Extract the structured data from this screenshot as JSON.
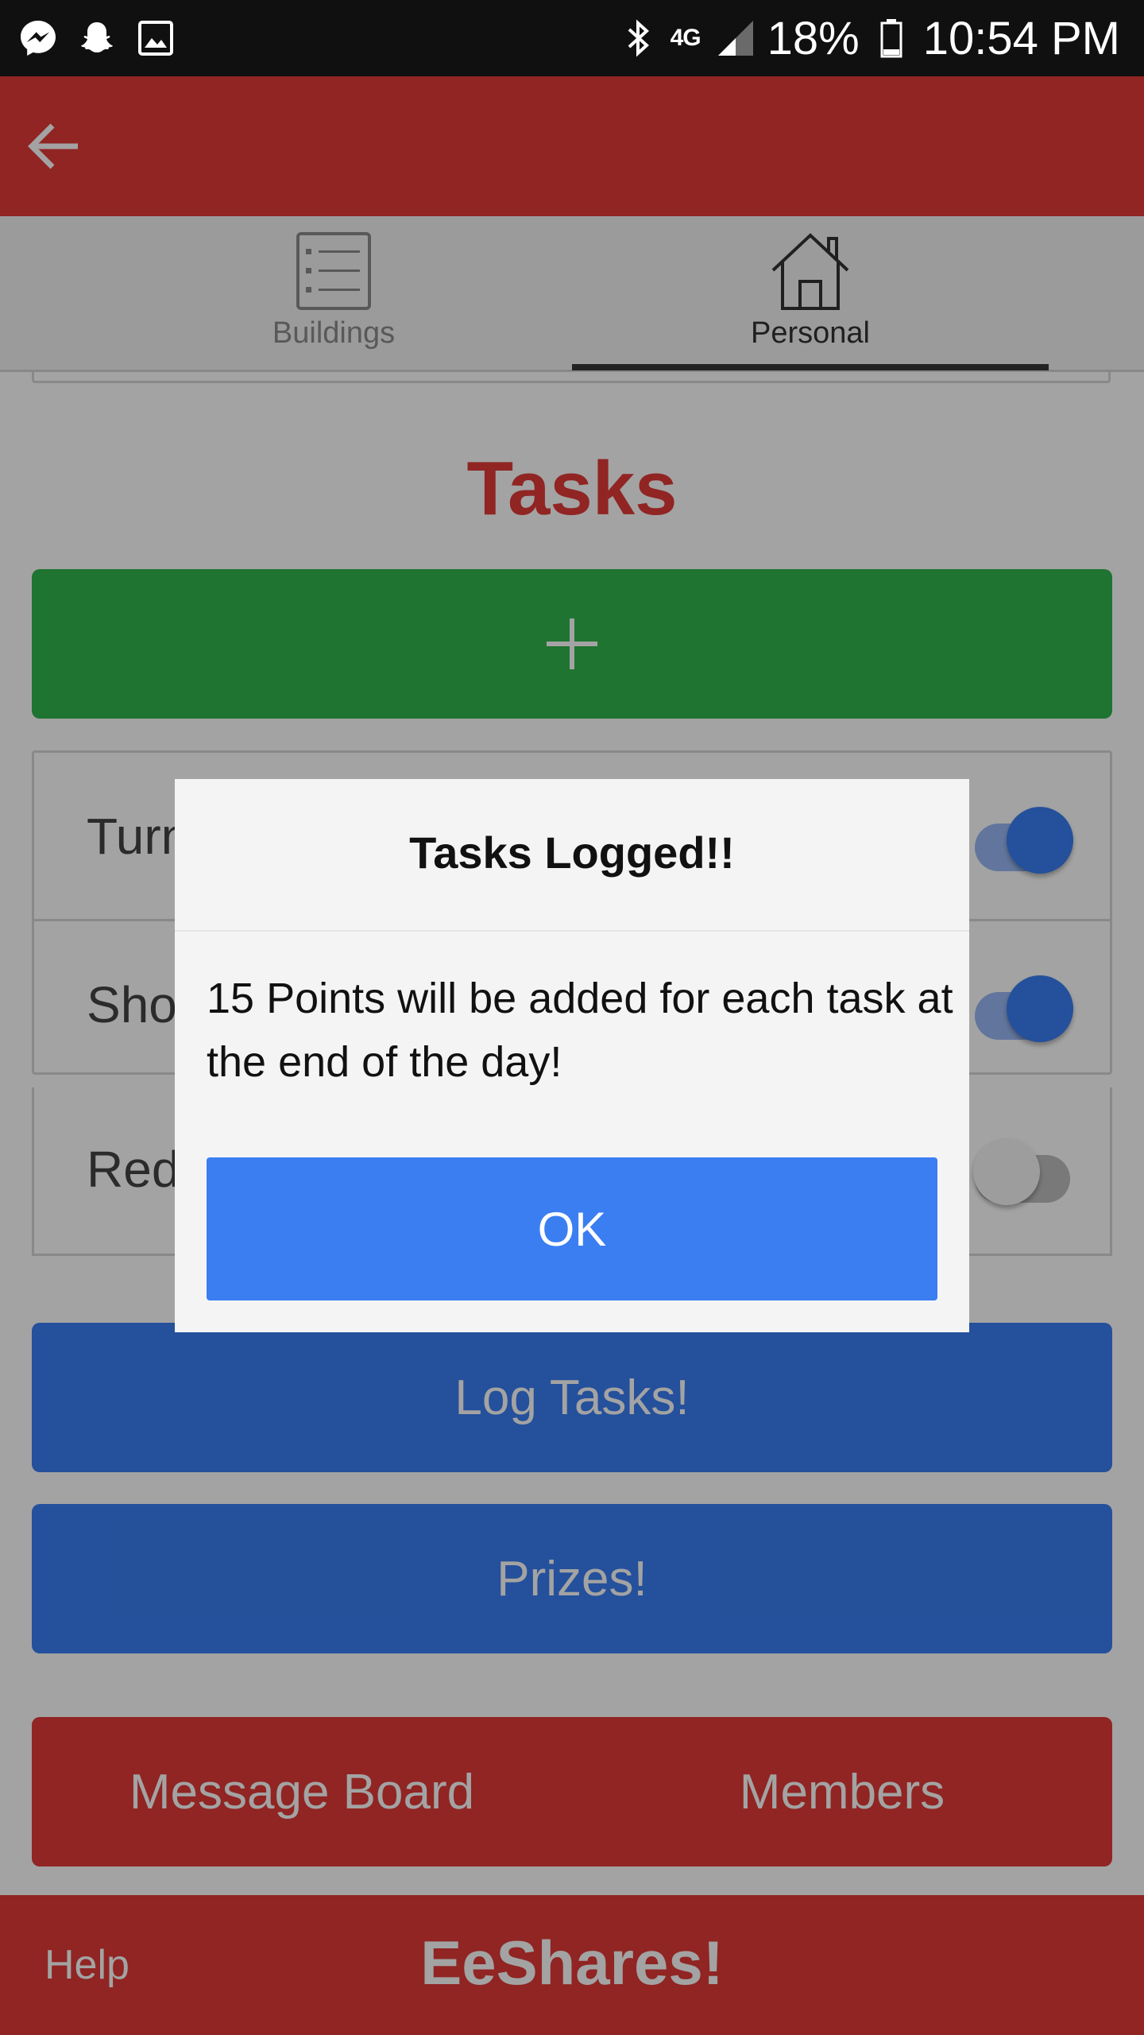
{
  "status_bar": {
    "network": "4G",
    "battery": "18%",
    "time": "10:54 PM",
    "icons": [
      "messenger-icon",
      "snapchat-icon",
      "gallery-icon",
      "bluetooth-icon",
      "signal-icon",
      "battery-icon"
    ]
  },
  "tabs": [
    {
      "label": "Buildings",
      "icon": "list-icon",
      "selected": false
    },
    {
      "label": "Personal",
      "icon": "home-icon",
      "selected": true
    }
  ],
  "tasks_section": {
    "title": "Tasks",
    "add_icon": "plus-icon",
    "items": [
      {
        "label": "Turn off AC",
        "enabled": true
      },
      {
        "label": "Shorter Showers",
        "enabled": true
      },
      {
        "label": "Reduce electricity",
        "enabled": false
      }
    ]
  },
  "buttons": {
    "log_tasks": "Log Tasks!",
    "prizes": "Prizes!",
    "message_board": "Message Board",
    "members": "Members"
  },
  "footer": {
    "help": "Help",
    "brand": "EeShares!"
  },
  "dialog": {
    "title": "Tasks Logged!!",
    "message": "15 Points will be added for each task at the end of the day!",
    "ok": "OK"
  },
  "colors": {
    "app_red": "#e23a37",
    "add_green": "#2fb64b",
    "button_blue": "#3a7ef2",
    "overlay": "rgba(0,0,0,0.36)"
  }
}
